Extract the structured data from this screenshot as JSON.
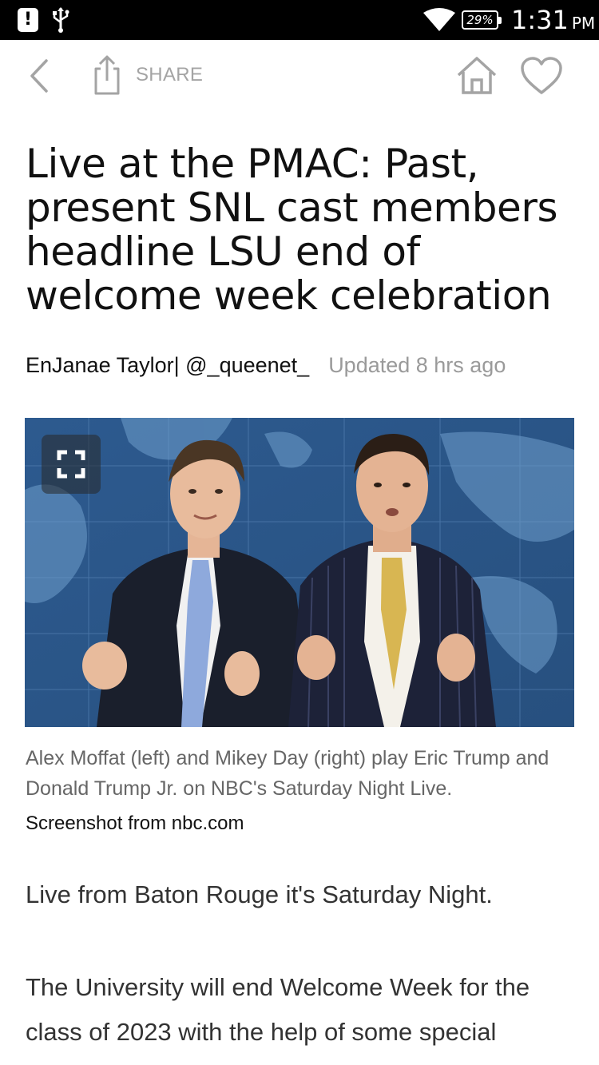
{
  "status_bar": {
    "alert_icon": "alert-icon",
    "usb_icon": "usb-icon",
    "wifi_icon": "wifi-icon",
    "battery_label": "29%",
    "time": "1:31",
    "ampm": "PM"
  },
  "toolbar": {
    "back_icon": "chevron-left-icon",
    "share_icon": "share-icon",
    "share_label": "SHARE",
    "home_icon": "home-icon",
    "favorite_icon": "heart-icon"
  },
  "article": {
    "headline": "Live at the PMAC: Past, present SNL cast members headline LSU end of welcome week celebration",
    "author": "EnJanae Taylor| @_queenet_",
    "updated": "Updated 8 hrs ago",
    "photo": {
      "expand_icon": "expand-icon",
      "caption": "Alex Moffat (left) and Mikey Day (right) play Eric Trump and Donald Trump Jr. on NBC's Saturday Night Live.",
      "credit": "Screenshot from nbc.com"
    },
    "paragraphs": [
      "Live from Baton Rouge it's Saturday Night.",
      "The University will end Welcome Week for the class of 2023 with the help of some special guests."
    ]
  },
  "colors": {
    "status_bar_bg": "#000000",
    "icon_gray": "#a4a4a4",
    "headline_text": "#111111",
    "muted_text": "#9a9a9a"
  }
}
